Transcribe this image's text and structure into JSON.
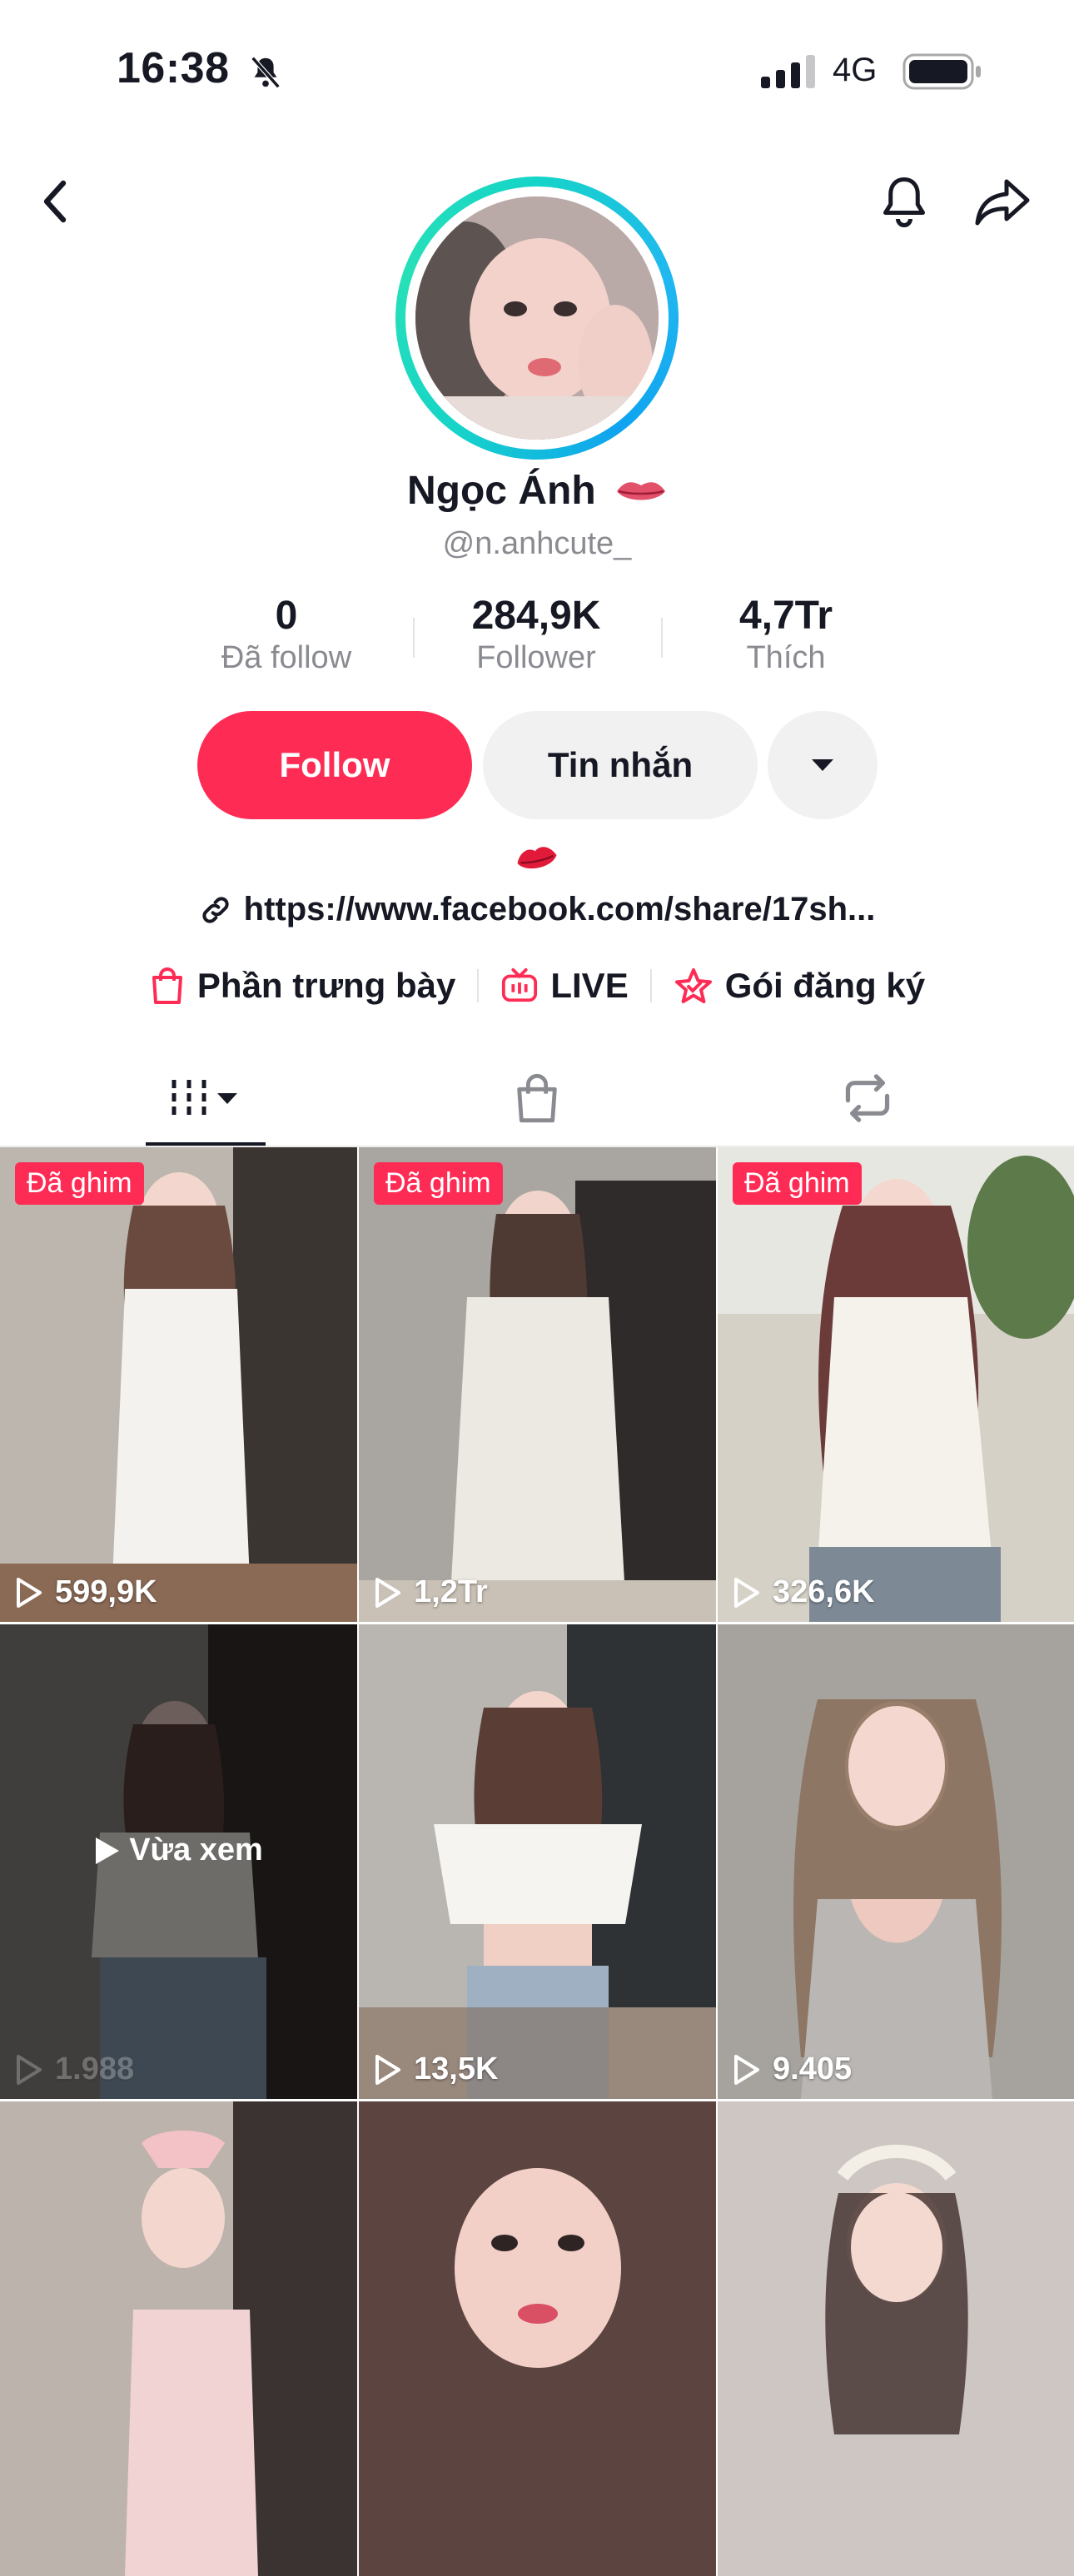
{
  "status_bar": {
    "time": "16:38",
    "network": "4G"
  },
  "profile": {
    "name": "Ngọc Ánh",
    "handle": "@n.anhcute_",
    "stats": [
      {
        "value": "0",
        "label": "Đã follow"
      },
      {
        "value": "284,9K",
        "label": "Follower"
      },
      {
        "value": "4,7Tr",
        "label": "Thích"
      }
    ],
    "follow_label": "Follow",
    "message_label": "Tin nhắn",
    "bio_link": "https://www.facebook.com/share/17sh..."
  },
  "features": [
    {
      "label": "Phần trưng bày",
      "icon": "shopping-bag-icon"
    },
    {
      "label": "LIVE",
      "icon": "live-tv-icon"
    },
    {
      "label": "Gói đăng ký",
      "icon": "subscription-star-icon"
    }
  ],
  "tabs": [
    {
      "name": "videos",
      "icon": "grid-videos-icon"
    },
    {
      "name": "shop",
      "icon": "bag-icon"
    },
    {
      "name": "reposts",
      "icon": "repost-icon"
    }
  ],
  "videos": [
    {
      "pinned": "Đã ghim",
      "views": "599,9K",
      "bg": "#b8b1a8"
    },
    {
      "pinned": "Đã ghim",
      "views": "1,2Tr",
      "bg": "#a7a39e"
    },
    {
      "pinned": "Đã ghim",
      "views": "326,6K",
      "bg": "#c9c3b6"
    },
    {
      "watched": "Vừa xem",
      "views": "1.988",
      "bg": "#6b6764"
    },
    {
      "views": "13,5K",
      "bg": "#8f8a86"
    },
    {
      "views": "9.405",
      "bg": "#9a9792"
    },
    {
      "bg": "#b7aba6"
    },
    {
      "bg": "#7c5a56"
    },
    {
      "bg": "#c2b8b4"
    }
  ],
  "colors": {
    "accent": "#fe2c55",
    "text": "#161823",
    "muted": "#8a8b91",
    "button_bg": "#f1f1f2"
  }
}
